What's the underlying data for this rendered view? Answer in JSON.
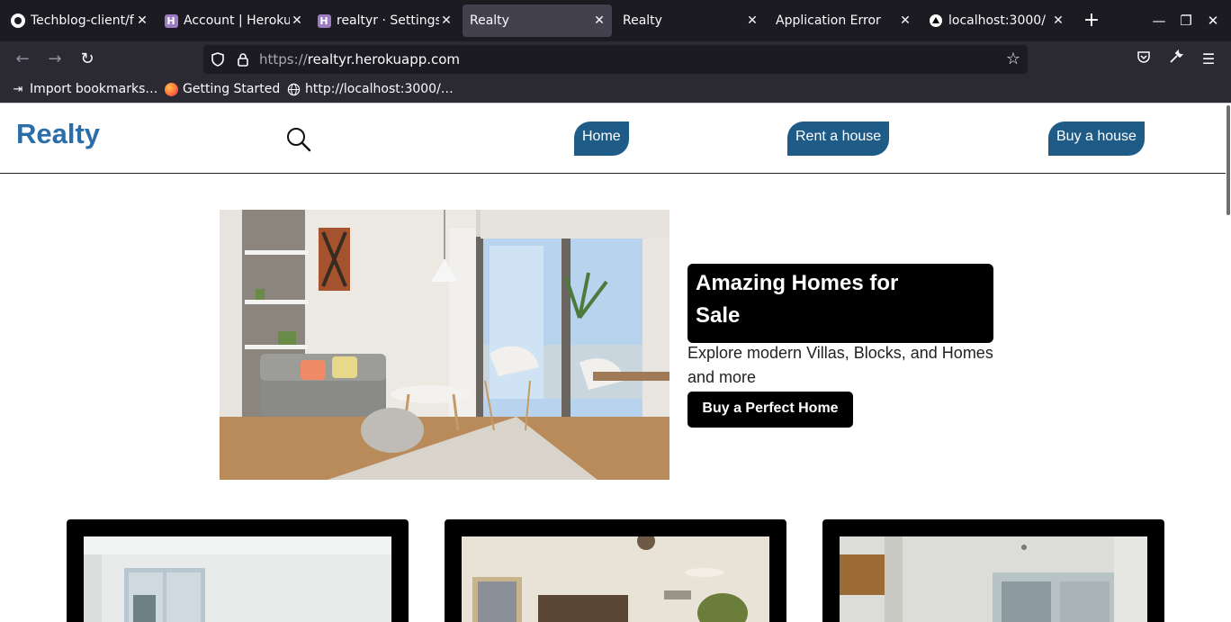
{
  "browser": {
    "tabs": [
      {
        "title": "Techblog-client/f",
        "favicon": "github-icon"
      },
      {
        "title": "Account | Heroku",
        "favicon": "heroku-icon"
      },
      {
        "title": "realtyr · Settings",
        "favicon": "heroku-icon"
      },
      {
        "title": "Realty",
        "favicon": "none",
        "active": true
      },
      {
        "title": "Realty",
        "favicon": "none"
      },
      {
        "title": "Application Error",
        "favicon": "none"
      },
      {
        "title": "localhost:3000/",
        "favicon": "vercel-triangle-icon"
      }
    ],
    "url_protocol": "https://",
    "url_host": "realtyr.herokuapp.com",
    "bookmarks": [
      {
        "label": "Import bookmarks…",
        "icon": "import-icon"
      },
      {
        "label": "Getting Started",
        "icon": "firefox-icon"
      },
      {
        "label": "http://localhost:3000/…",
        "icon": "globe-icon"
      }
    ]
  },
  "site": {
    "brand": "Realty",
    "nav": [
      "Home",
      "Rent a house",
      "Buy a house"
    ],
    "hero": {
      "title_line1": "Amazing Homes for",
      "title_line2": "Sale",
      "subtitle": "Explore modern Villas, Blocks, and Homes and more",
      "cta": "Buy a Perfect Home"
    },
    "colors": {
      "brand": "#2b6da8",
      "nav_pill": "#1e5b87",
      "hero_title_bg": "#000000"
    }
  }
}
